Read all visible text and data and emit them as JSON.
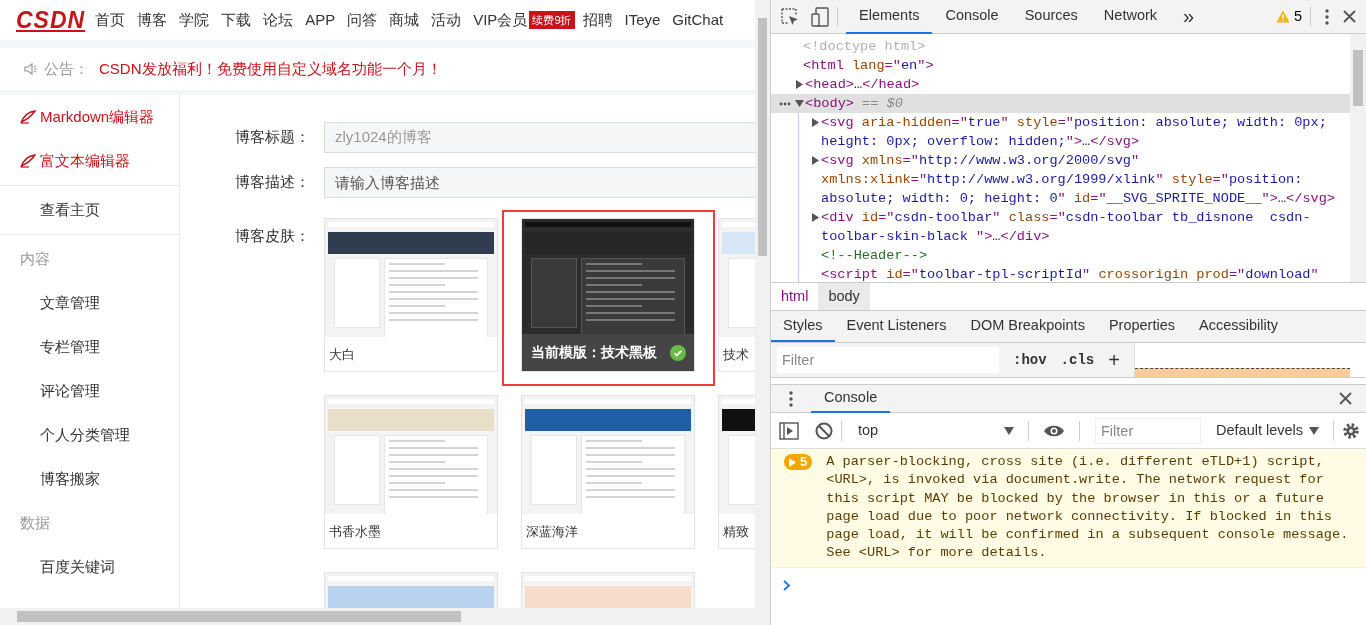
{
  "site_nav": {
    "logo": "CSDN",
    "items": [
      {
        "label": "首页"
      },
      {
        "label": "博客"
      },
      {
        "label": "学院"
      },
      {
        "label": "下载"
      },
      {
        "label": "论坛"
      },
      {
        "label": "APP"
      },
      {
        "label": "问答"
      },
      {
        "label": "商城"
      },
      {
        "label": "活动"
      },
      {
        "label": "VIP会员",
        "badge": "续费9折"
      },
      {
        "label": "招聘"
      },
      {
        "label": "ITeye"
      },
      {
        "label": "GitChat"
      }
    ]
  },
  "notice": {
    "label": "公告：",
    "text": "CSDN发放福利！免费使用自定义域名功能一个月！"
  },
  "sidebar": {
    "items": [
      {
        "kind": "editor",
        "label": "Markdown编辑器"
      },
      {
        "kind": "editor",
        "label": "富文本编辑器"
      },
      {
        "kind": "divider"
      },
      {
        "kind": "link",
        "label": "查看主页"
      },
      {
        "kind": "divider"
      },
      {
        "kind": "heading",
        "label": "内容"
      },
      {
        "kind": "link",
        "label": "文章管理"
      },
      {
        "kind": "link",
        "label": "专栏管理"
      },
      {
        "kind": "link",
        "label": "评论管理"
      },
      {
        "kind": "link",
        "label": "个人分类管理"
      },
      {
        "kind": "link",
        "label": "博客搬家"
      },
      {
        "kind": "heading",
        "label": "数据"
      },
      {
        "kind": "link",
        "label": "百度关键词"
      }
    ]
  },
  "form": {
    "fields": [
      {
        "label": "博客标题：",
        "value": "zly1024的博客",
        "disabled": true
      },
      {
        "label": "博客描述：",
        "placeholder": "请输入博客描述",
        "disabled": false
      }
    ],
    "skins": {
      "label": "博客皮肤：",
      "items": [
        {
          "caption": "大白",
          "selected": false,
          "kind": "light",
          "color": "#2f3d4f"
        },
        {
          "caption": "当前模版：技术黑板",
          "selected": true,
          "kind": "dark",
          "color": "#262626"
        },
        {
          "caption": "技术",
          "selected": false,
          "kind": "light",
          "color": "#d7e6f6"
        },
        {
          "caption": "书香水墨",
          "selected": false,
          "kind": "light",
          "color": "#e9dfc8"
        },
        {
          "caption": "深蓝海洋",
          "selected": false,
          "kind": "light",
          "color": "#1f5fa6"
        },
        {
          "caption": "精致",
          "selected": false,
          "kind": "light",
          "color": "#111111"
        },
        {
          "selected": false,
          "kind": "light",
          "color": "#b9d2f0"
        },
        {
          "selected": false,
          "kind": "light",
          "color": "#f7dccb"
        }
      ]
    }
  },
  "devtools": {
    "tabs": [
      {
        "label": "Elements",
        "selected": true
      },
      {
        "label": "Console",
        "selected": false
      },
      {
        "label": "Sources",
        "selected": false
      },
      {
        "label": "Network",
        "selected": false
      }
    ],
    "more": "»",
    "warning_count": "5",
    "dom_tree": [
      {
        "selected": false,
        "tokens": [
          {
            "kind": "doctype",
            "text": "<!doctype html>"
          }
        ]
      },
      {
        "selected": false,
        "tokens": [
          {
            "kind": "tag",
            "text": "<html "
          },
          {
            "kind": "attr",
            "text": "lang"
          },
          {
            "kind": "tag",
            "text": "=\""
          },
          {
            "kind": "value",
            "text": "en"
          },
          {
            "kind": "tag",
            "text": "\">"
          }
        ],
        "children": [
          {
            "expanded": false,
            "selected": false,
            "tokens": [
              {
                "kind": "tag",
                "text": "<head>"
              },
              {
                "kind": "text",
                "text": "…"
              },
              {
                "kind": "tag",
                "text": "</head>"
              }
            ]
          },
          {
            "expanded": true,
            "selected": true,
            "tokens": [
              {
                "kind": "tag",
                "text": "<body>"
              },
              {
                "kind": "hint",
                "text": " == $0"
              }
            ],
            "children": [
              {
                "expanded": false,
                "selected": false,
                "tokens": [
                  {
                    "kind": "tag",
                    "text": "<svg "
                  },
                  {
                    "kind": "attr",
                    "text": "aria-hidden"
                  },
                  {
                    "kind": "tag",
                    "text": "=\""
                  },
                  {
                    "kind": "value",
                    "text": "true"
                  },
                  {
                    "kind": "tag",
                    "text": "\" "
                  },
                  {
                    "kind": "attr",
                    "text": "style"
                  },
                  {
                    "kind": "tag",
                    "text": "=\""
                  },
                  {
                    "kind": "value",
                    "text": "position: absolute; width: 0px; height: 0px; overflow: hidden;"
                  },
                  {
                    "kind": "tag",
                    "text": "\">"
                  },
                  {
                    "kind": "text",
                    "text": "…"
                  },
                  {
                    "kind": "tag",
                    "text": "</svg>"
                  }
                ]
              },
              {
                "expanded": false,
                "selected": false,
                "tokens": [
                  {
                    "kind": "tag",
                    "text": "<svg "
                  },
                  {
                    "kind": "attr",
                    "text": "xmlns"
                  },
                  {
                    "kind": "tag",
                    "text": "=\""
                  },
                  {
                    "kind": "value",
                    "text": "http://www.w3.org/2000/svg"
                  },
                  {
                    "kind": "tag",
                    "text": "\" "
                  },
                  {
                    "kind": "attr",
                    "text": "xmlns:xlink"
                  },
                  {
                    "kind": "tag",
                    "text": "=\""
                  },
                  {
                    "kind": "value",
                    "text": "http://www.w3.org/1999/xlink"
                  },
                  {
                    "kind": "tag",
                    "text": "\" "
                  },
                  {
                    "kind": "attr",
                    "text": "style"
                  },
                  {
                    "kind": "tag",
                    "text": "=\""
                  },
                  {
                    "kind": "value",
                    "text": "position: absolute; width: 0; height: 0"
                  },
                  {
                    "kind": "tag",
                    "text": "\" "
                  },
                  {
                    "kind": "attr",
                    "text": "id"
                  },
                  {
                    "kind": "tag",
                    "text": "=\""
                  },
                  {
                    "kind": "value",
                    "text": "__SVG_SPRITE_NODE__"
                  },
                  {
                    "kind": "tag",
                    "text": "\">"
                  },
                  {
                    "kind": "text",
                    "text": "…"
                  },
                  {
                    "kind": "tag",
                    "text": "</svg>"
                  }
                ]
              },
              {
                "expanded": false,
                "selected": false,
                "tokens": [
                  {
                    "kind": "tag",
                    "text": "<div "
                  },
                  {
                    "kind": "attr",
                    "text": "id"
                  },
                  {
                    "kind": "tag",
                    "text": "=\""
                  },
                  {
                    "kind": "value",
                    "text": "csdn-toolbar"
                  },
                  {
                    "kind": "tag",
                    "text": "\" "
                  },
                  {
                    "kind": "attr",
                    "text": "class"
                  },
                  {
                    "kind": "tag",
                    "text": "=\""
                  },
                  {
                    "kind": "value",
                    "text": "csdn-toolbar tb_disnone  csdn-toolbar-skin-black "
                  },
                  {
                    "kind": "tag",
                    "text": "\">"
                  },
                  {
                    "kind": "text",
                    "text": "…"
                  },
                  {
                    "kind": "tag",
                    "text": "</div>"
                  }
                ]
              },
              {
                "selected": false,
                "tokens": [
                  {
                    "kind": "comment",
                    "text": "<!--Header-->"
                  }
                ]
              },
              {
                "selected": false,
                "tokens": [
                  {
                    "kind": "tag",
                    "text": "<script "
                  },
                  {
                    "kind": "attr",
                    "text": "id"
                  },
                  {
                    "kind": "tag",
                    "text": "=\""
                  },
                  {
                    "kind": "value",
                    "text": "toolbar-tpl-scriptId"
                  },
                  {
                    "kind": "tag",
                    "text": "\" "
                  },
                  {
                    "kind": "attr",
                    "text": "crossorigin prod"
                  },
                  {
                    "kind": "tag",
                    "text": "=\""
                  },
                  {
                    "kind": "value",
                    "text": "download"
                  },
                  {
                    "kind": "tag",
                    "text": "\""
                  }
                ]
              }
            ]
          }
        ]
      }
    ],
    "breadcrumbs": [
      {
        "label": "html",
        "selected": false
      },
      {
        "label": "body",
        "selected": true
      }
    ],
    "side_tabs": [
      {
        "label": "Styles",
        "selected": true
      },
      {
        "label": "Event Listeners",
        "selected": false
      },
      {
        "label": "DOM Breakpoints",
        "selected": false
      },
      {
        "label": "Properties",
        "selected": false
      },
      {
        "label": "Accessibility",
        "selected": false
      }
    ],
    "styles_filter": {
      "placeholder": "Filter"
    },
    "hov": ":hov",
    "cls": ".cls",
    "add": "+",
    "drawer": {
      "tab": "Console",
      "context": "top",
      "filter": {
        "placeholder": "Filter"
      },
      "levels": "Default levels",
      "messages": [
        {
          "kind": "warning",
          "count": "5",
          "text": "A parser-blocking, cross site (i.e. different eTLD+1) script, <URL>, is invoked via document.write. The network request for this script MAY be blocked by the browser in this or a future page load due to poor network connectivity. If blocked in this page load, it will be confirmed in a subsequent console message. See <URL> for more details."
        }
      ]
    }
  }
}
